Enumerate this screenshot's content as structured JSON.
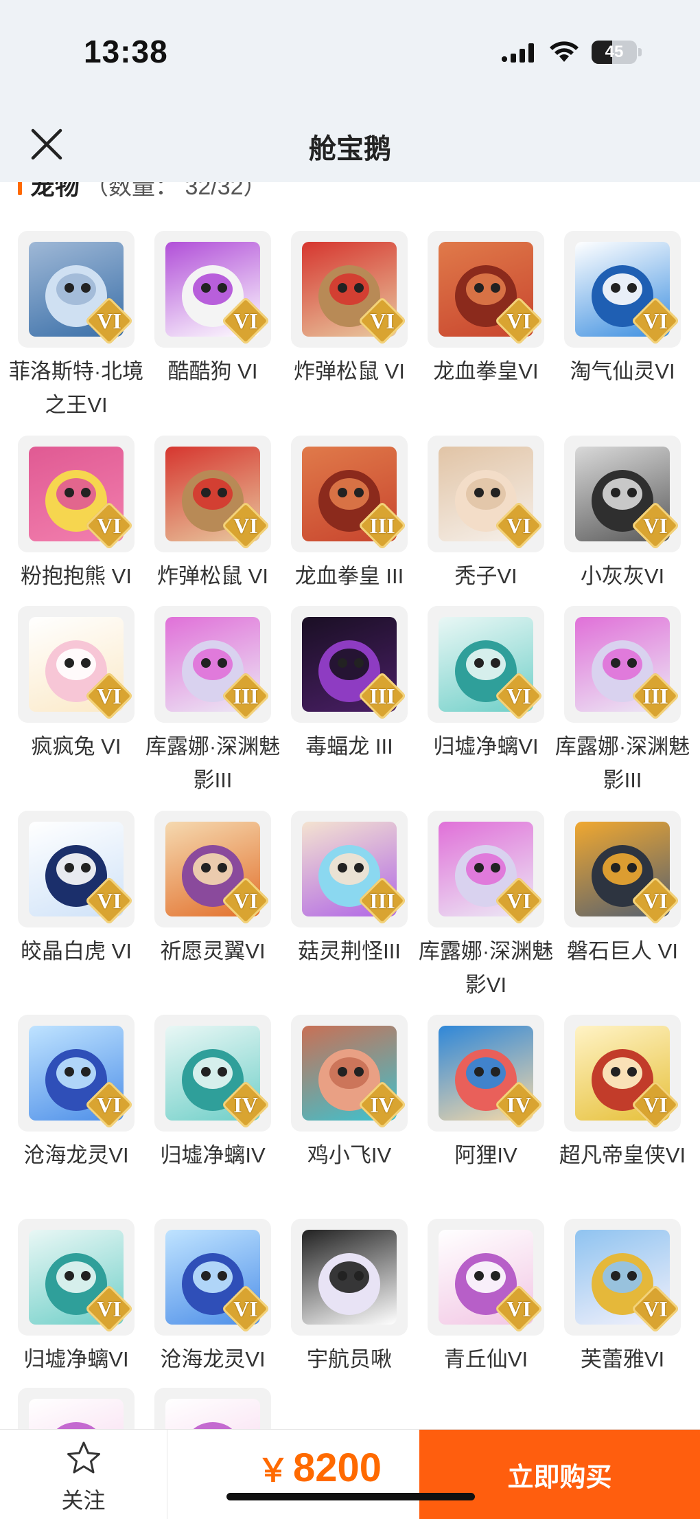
{
  "status_bar": {
    "time": "13:38",
    "battery": "45",
    "battery_level": 0.45
  },
  "header": {
    "title": "舱宝鹅"
  },
  "section": {
    "label": "宠物",
    "count_text": "（数量： 32/32）"
  },
  "colors": {
    "accent": "#ff5e0e",
    "price": "#ff6a00",
    "rank_badge": "#d9a431"
  },
  "pets": [
    {
      "name": "菲洛斯特·北境之王VI",
      "rank": "VI",
      "art": "silver-knight"
    },
    {
      "name": "酷酷狗 VI",
      "rank": "VI",
      "art": "white-bear-goggles"
    },
    {
      "name": "炸弹松鼠 VI",
      "rank": "VI",
      "art": "squirrel-hat"
    },
    {
      "name": "龙血拳皇VI",
      "rank": "VI",
      "art": "red-ram"
    },
    {
      "name": "淘气仙灵VI",
      "rank": "VI",
      "art": "blue-dog"
    },
    {
      "name": "粉抱抱熊 VI",
      "rank": "VI",
      "art": "pink-bear"
    },
    {
      "name": "炸弹松鼠 VI",
      "rank": "VI",
      "art": "squirrel-hat"
    },
    {
      "name": "龙血拳皇 III",
      "rank": "III",
      "art": "red-ram"
    },
    {
      "name": "秃子VI",
      "rank": "VI",
      "art": "bald-kid"
    },
    {
      "name": "小灰灰VI",
      "rank": "VI",
      "art": "grey-wolf"
    },
    {
      "name": "疯疯兔 VI",
      "rank": "VI",
      "art": "pink-rabbit"
    },
    {
      "name": "库露娜·深渊魅影III",
      "rank": "III",
      "art": "white-hair-girl"
    },
    {
      "name": "毒蝠龙 III",
      "rank": "III",
      "art": "purple-dragon"
    },
    {
      "name": "归墟净螭VI",
      "rank": "VI",
      "art": "teal-dragon"
    },
    {
      "name": "库露娜·深渊魅影III",
      "rank": "III",
      "art": "white-hair-girl"
    },
    {
      "name": "皎晶白虎 VI",
      "rank": "VI",
      "art": "white-tiger"
    },
    {
      "name": "祈愿灵翼VI",
      "rank": "VI",
      "art": "eagle"
    },
    {
      "name": "菇灵荆怪III",
      "rank": "III",
      "art": "purple-mushroom"
    },
    {
      "name": "库露娜·深渊魅影VI",
      "rank": "VI",
      "art": "white-hair-girl"
    },
    {
      "name": "磐石巨人 VI",
      "rank": "VI",
      "art": "stone-giant"
    },
    {
      "name": "沧海龙灵VI",
      "rank": "VI",
      "art": "blue-dragon-boy"
    },
    {
      "name": "归墟净螭IV",
      "rank": "IV",
      "art": "teal-dragon"
    },
    {
      "name": "鸡小飞IV",
      "rank": "IV",
      "art": "chick-muscle"
    },
    {
      "name": "阿狸IV",
      "rank": "IV",
      "art": "ali-fox"
    },
    {
      "name": "超凡帝皇侠VI",
      "rank": "VI",
      "art": "gold-armor"
    },
    {
      "name": "归墟净螭VI",
      "rank": "VI",
      "art": "teal-dragon"
    },
    {
      "name": "沧海龙灵VI",
      "rank": "VI",
      "art": "blue-dragon-boy"
    },
    {
      "name": "宇航员啾",
      "rank": "",
      "art": "astronaut"
    },
    {
      "name": "青丘仙VI",
      "rank": "VI",
      "art": "fox-girl"
    },
    {
      "name": "芙蕾雅VI",
      "rank": "VI",
      "art": "gold-crown-girl"
    },
    {
      "name": "",
      "rank": "",
      "art": "pink-fox-partial"
    },
    {
      "name": "",
      "rank": "",
      "art": "pink-fox-partial"
    }
  ],
  "bottom_bar": {
    "follow_label": "关注",
    "follow_icon": "star-outline-icon",
    "price_currency": "￥",
    "price_amount": "8200",
    "buy_label": "立即购买"
  }
}
